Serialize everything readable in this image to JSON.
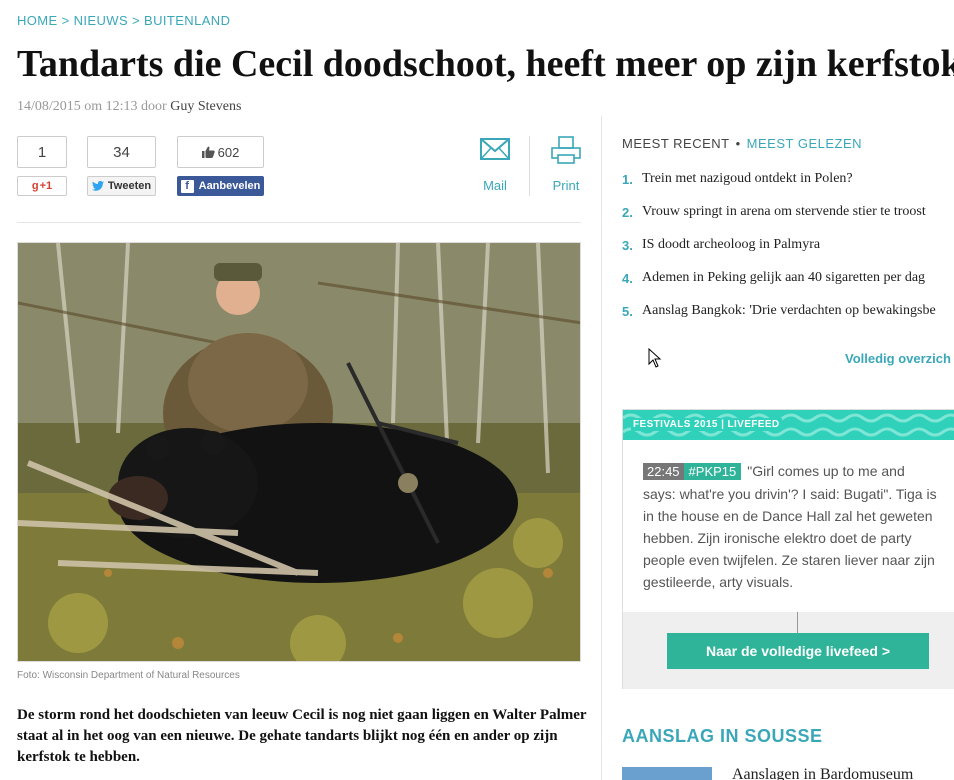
{
  "breadcrumb": {
    "items": [
      "HOME",
      "NIEUWS",
      "BUITENLAND"
    ],
    "separator": ">"
  },
  "article": {
    "title": "Tandarts die Cecil doodschoot, heeft meer op zijn kerfstok",
    "date": "14/08/2015 om 12:13 door",
    "author": "Guy Stevens",
    "photo_caption": "Foto: Wisconsin Department of Natural Resources",
    "lead": "De storm rond het doodschieten van leeuw Cecil is nog niet gaan liggen en Walter Palmer staat al in het oog van een nieuwe. De gehate tandarts blijkt nog één en ander op zijn kerfstok te hebben."
  },
  "share": {
    "gplus": {
      "count": "1",
      "label": "+1",
      "icon": "g"
    },
    "twitter": {
      "count": "34",
      "label": "Tweeten"
    },
    "facebook": {
      "count": "602",
      "label": "Aanbevelen"
    },
    "mail_label": "Mail",
    "print_label": "Print"
  },
  "sidebar": {
    "tab_active": "MEEST RECENT",
    "tab_dot": "•",
    "tab_other": "MEEST GELEZEN",
    "recent": [
      {
        "num": "1.",
        "title": "Trein met nazigoud ontdekt in Polen?"
      },
      {
        "num": "2.",
        "title": "Vrouw springt in arena om stervende stier te troost"
      },
      {
        "num": "3.",
        "title": "IS doodt archeoloog in Palmyra"
      },
      {
        "num": "4.",
        "title": "Ademen in Peking gelijk aan 40 sigaretten per dag"
      },
      {
        "num": "5.",
        "title": "Aanslag Bangkok: 'Drie verdachten op bewakingsbe"
      }
    ],
    "more_link": "Volledig overzich"
  },
  "festival": {
    "label": "FESTIVALS 2015 | LIVEFEED",
    "time": "22:45",
    "tag": "#PKP15",
    "text": "\"Girl comes up to me and says: what're you drivin'? I said: Bugati\". Tiga is in the house en de Dance Hall zal het geweten hebben. Zijn ironische elektro doet de party people even twijfelen. Ze staren liever naar zijn gestileerde, arty visuals.",
    "button": "Naar de volledige livefeed >"
  },
  "aanslag": {
    "heading": "AANSLAG IN SOUSSE",
    "first_title": "Aanslagen in Bardomuseum"
  },
  "colors": {
    "accent": "#3aa7b9",
    "festival_green": "#2fd1bb",
    "button_green": "#2fb49a",
    "facebook": "#3b5998"
  }
}
